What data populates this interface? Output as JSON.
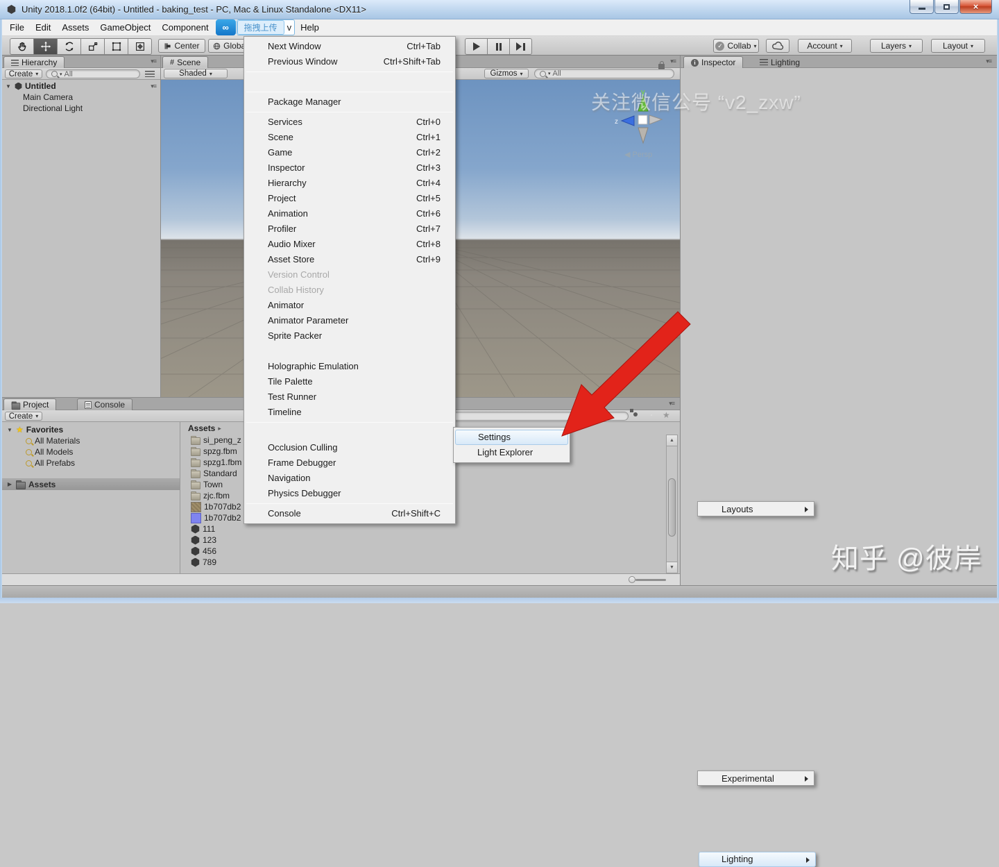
{
  "window": {
    "title": "Unity 2018.1.0f2 (64bit) - Untitled - baking_test - PC, Mac & Linux Standalone <DX11>"
  },
  "menubar": {
    "items": [
      "File",
      "Edit",
      "Assets",
      "GameObject",
      "Component"
    ],
    "upload_overlay": "拖拽上传",
    "covered_text": "v",
    "help": "Help"
  },
  "toolbar": {
    "tools": [
      "hand-tool",
      "move-tool",
      "rotate-tool",
      "scale-tool",
      "rect-tool",
      "transform-tool"
    ],
    "active_tool": "move-tool",
    "pivot": "Center",
    "space": "Global",
    "collab": "Collab",
    "account": "Account",
    "layers": "Layers",
    "layout": "Layout"
  },
  "hierarchy": {
    "tab": "Hierarchy",
    "create": "Create",
    "search_placeholder": "All",
    "root": "Untitled",
    "items": [
      "Main Camera",
      "Directional Light"
    ]
  },
  "scene": {
    "tab": "Scene",
    "shading": "Shaded",
    "gizmos": "Gizmos",
    "search_placeholder": "All",
    "persp": "Persp",
    "axis_y": "y",
    "axis_z": "z"
  },
  "inspector": {
    "tab": "Inspector",
    "tab_lighting": "Lighting"
  },
  "project": {
    "tab": "Project",
    "tab_console": "Console",
    "create": "Create",
    "favorites_label": "Favorites",
    "favorites": [
      "All Materials",
      "All Models",
      "All Prefabs"
    ],
    "assets_label": "Assets",
    "breadcrumb": "Assets",
    "files": [
      {
        "name": "si_peng_z",
        "icon": "folder"
      },
      {
        "name": "spzg.fbm",
        "icon": "folder"
      },
      {
        "name": "spzg1.fbm",
        "icon": "folder"
      },
      {
        "name": "Standard",
        "icon": "folder"
      },
      {
        "name": "Town",
        "icon": "folder"
      },
      {
        "name": "zjc.fbm",
        "icon": "folder"
      },
      {
        "name": "1b707db2",
        "icon": "texture"
      },
      {
        "name": "1b707db2",
        "icon": "material"
      },
      {
        "name": "111",
        "icon": "unity"
      },
      {
        "name": "123",
        "icon": "unity"
      },
      {
        "name": "456",
        "icon": "unity"
      },
      {
        "name": "789",
        "icon": "unity"
      }
    ]
  },
  "window_menu": {
    "items": [
      {
        "label": "Next Window",
        "shortcut": "Ctrl+Tab"
      },
      {
        "label": "Previous Window",
        "shortcut": "Ctrl+Shift+Tab"
      },
      {
        "separator": true
      },
      {
        "label": "Layouts",
        "submenu": true
      },
      {
        "separator": true
      },
      {
        "label": "Package Manager"
      },
      {
        "separator": true
      },
      {
        "label": "Services",
        "shortcut": "Ctrl+0"
      },
      {
        "label": "Scene",
        "shortcut": "Ctrl+1"
      },
      {
        "label": "Game",
        "shortcut": "Ctrl+2"
      },
      {
        "label": "Inspector",
        "shortcut": "Ctrl+3"
      },
      {
        "label": "Hierarchy",
        "shortcut": "Ctrl+4"
      },
      {
        "label": "Project",
        "shortcut": "Ctrl+5"
      },
      {
        "label": "Animation",
        "shortcut": "Ctrl+6"
      },
      {
        "label": "Profiler",
        "shortcut": "Ctrl+7"
      },
      {
        "label": "Audio Mixer",
        "shortcut": "Ctrl+8"
      },
      {
        "label": "Asset Store",
        "shortcut": "Ctrl+9"
      },
      {
        "label": "Version Control",
        "disabled": true
      },
      {
        "label": "Collab History",
        "disabled": true
      },
      {
        "label": "Animator"
      },
      {
        "label": "Animator Parameter"
      },
      {
        "label": "Sprite Packer"
      },
      {
        "label": "Experimental",
        "submenu": true
      },
      {
        "label": "Holographic Emulation"
      },
      {
        "label": "Tile Palette"
      },
      {
        "label": "Test Runner"
      },
      {
        "label": "Timeline"
      },
      {
        "separator": true
      },
      {
        "label": "Lighting",
        "submenu": true,
        "highlight": true
      },
      {
        "label": "Occlusion Culling"
      },
      {
        "label": "Frame Debugger"
      },
      {
        "label": "Navigation"
      },
      {
        "label": "Physics Debugger"
      },
      {
        "separator": true
      },
      {
        "label": "Console",
        "shortcut": "Ctrl+Shift+C"
      }
    ]
  },
  "lighting_submenu": {
    "items": [
      {
        "label": "Settings",
        "highlight": true
      },
      {
        "label": "Light Explorer"
      }
    ]
  },
  "watermarks": {
    "top": "关注微信公号 “v2_zxw”",
    "bottom": "知乎 @彼岸"
  },
  "icons": {
    "toolbar": [
      "hand-icon",
      "move-icon",
      "rotate-icon",
      "scale-icon",
      "rect-icon",
      "transform-icon"
    ],
    "misc": [
      "search-icon",
      "lock-icon",
      "pane-menu-icon",
      "cloud-icon",
      "collab-check-icon",
      "star-icon",
      "folder-icon",
      "unity-cube-icon",
      "info-icon"
    ]
  },
  "colors": {
    "arrow_red": "#e2231a",
    "menu_highlight_border": "#a9cbe9",
    "titlebar_blue": "#bed6ee",
    "sky_top": "#6d93c0",
    "ground": "#8a857e"
  }
}
